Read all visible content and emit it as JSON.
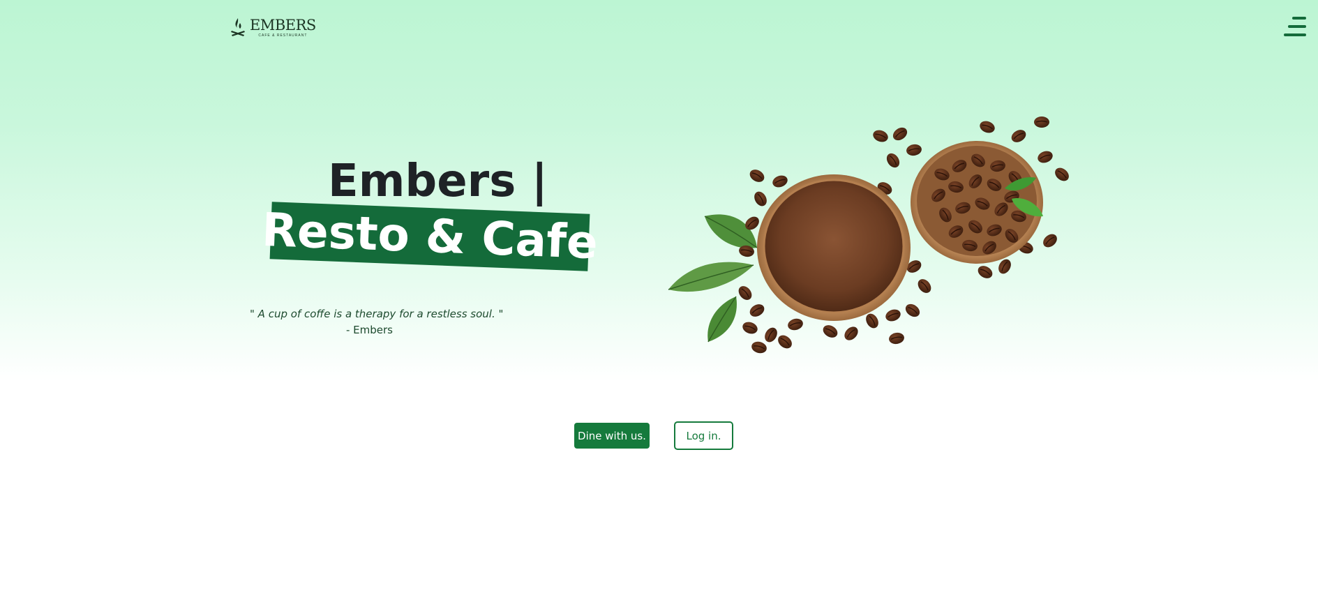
{
  "header": {
    "logo_name": "EMBERS",
    "logo_tagline": "CAFE & RESTAURANT"
  },
  "hero": {
    "title_line1": "Embers |",
    "title_line2": "Resto & Cafe",
    "quote": "\" A cup of coffe is a therapy for a restless soul. \"",
    "quote_author": "- Embers"
  },
  "actions": {
    "dine_label": "Dine with us.",
    "login_label": "Log in."
  },
  "colors": {
    "brand_green": "#146b3a",
    "button_green": "#157a3c",
    "gradient_top": "#bcf5d3",
    "text_dark": "#1e2226"
  },
  "icons": {
    "menu": "hamburger-menu-icon",
    "logo": "flame-logo-icon"
  }
}
